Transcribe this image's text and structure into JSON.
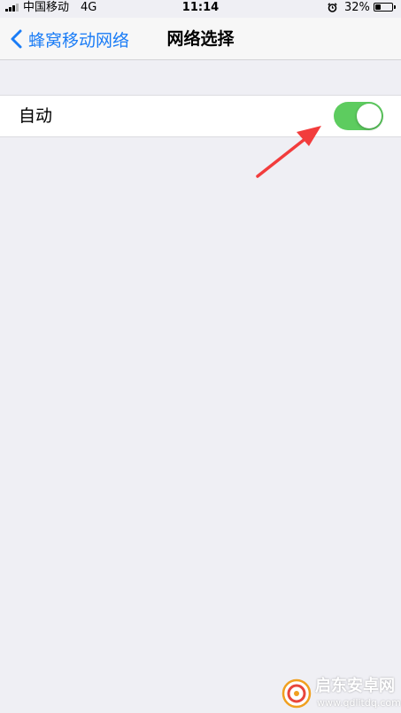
{
  "status_bar": {
    "carrier": "中国移动",
    "network": "4G",
    "time": "11:14",
    "battery_percent": "32%",
    "battery_level": 0.32,
    "signal_bars": 3,
    "alarm_icon": "alarm-clock-icon"
  },
  "nav": {
    "back_label": "蜂窝移动网络",
    "title": "网络选择",
    "back_icon": "chevron-left-icon",
    "accent_color": "#1a7cf6"
  },
  "settings": {
    "auto_label": "自动",
    "auto_toggle_on": true,
    "toggle_on_color": "#5dcc5f"
  },
  "annotation": {
    "icon": "red-arrow-icon",
    "color": "#f23c3c"
  },
  "watermark": {
    "title": "启东安卓网",
    "url": "www.qdlitdq.com"
  }
}
